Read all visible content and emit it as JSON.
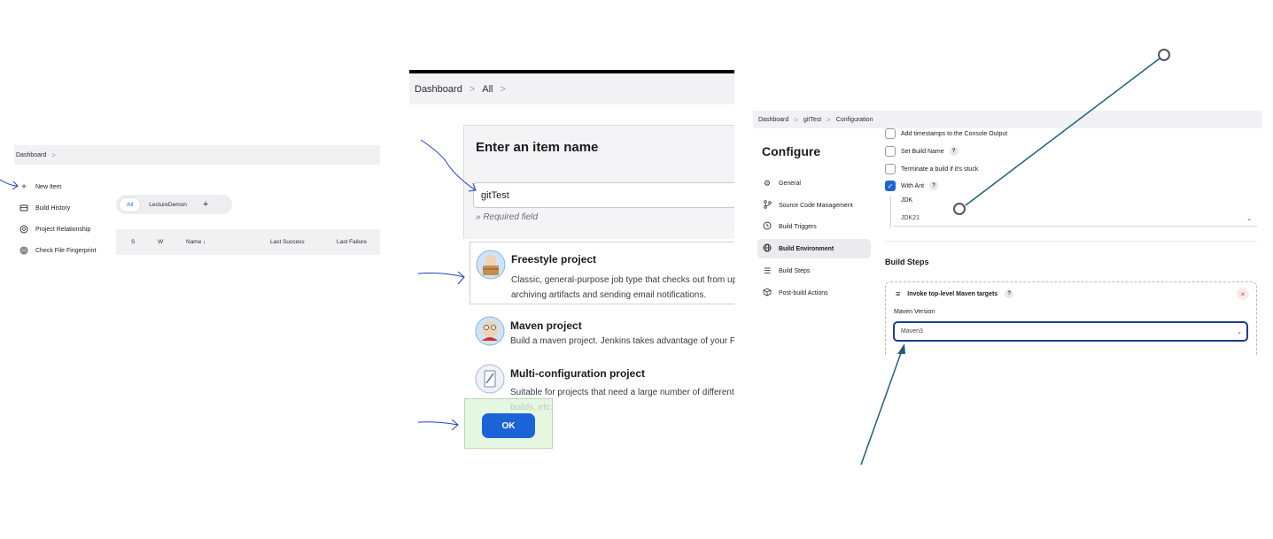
{
  "panel1": {
    "breadcrumb": {
      "home": "Dashboard",
      "sep": ">"
    },
    "sidebar": [
      {
        "label": "New Item",
        "icon": "plus-icon"
      },
      {
        "label": "Build History",
        "icon": "history-icon"
      },
      {
        "label": "Project Relationship",
        "icon": "relationship-icon"
      },
      {
        "label": "Check File Fingerprint",
        "icon": "fingerprint-icon"
      }
    ],
    "tabs": {
      "all": "All",
      "view": "LectureDemon",
      "add": "+"
    },
    "table_headers": {
      "s": "S",
      "w": "W",
      "name": "Name ↓",
      "last_success": "Last Success",
      "last_failure": "Last Failure"
    }
  },
  "panel2": {
    "breadcrumb": {
      "home": "Dashboard",
      "all": "All",
      "sep": ">"
    },
    "title": "Enter an item name",
    "input_value": "gitTest",
    "required_note": "» Required field",
    "projects": [
      {
        "name": "Freestyle project",
        "desc1": "Classic, general-purpose job type that checks out from up to o",
        "desc2": "archiving artifacts and sending email notifications."
      },
      {
        "name": "Maven project",
        "desc1": "Build a maven project. Jenkins takes advantage of your POM f",
        "desc2": ""
      },
      {
        "name": "Multi-configuration project",
        "desc1": "Suitable for projects that need a large number of different con",
        "desc2": "builds, etc."
      }
    ],
    "ok_label": "OK"
  },
  "panel3": {
    "breadcrumb": {
      "home": "Dashboard",
      "job": "gitTest",
      "page": "Configuration",
      "sep": ">"
    },
    "title": "Configure",
    "nav": [
      {
        "label": "General",
        "icon": "gear-icon"
      },
      {
        "label": "Source Code Management",
        "icon": "branch-icon"
      },
      {
        "label": "Build Triggers",
        "icon": "clock-icon"
      },
      {
        "label": "Build Environment",
        "icon": "globe-icon"
      },
      {
        "label": "Build Steps",
        "icon": "list-icon"
      },
      {
        "label": "Post-build Actions",
        "icon": "cube-icon"
      }
    ],
    "options": {
      "timestamps": "Add timestamps to the Console Output",
      "build_name": "Set Build Name",
      "terminate": "Terminate a build if it's stuck",
      "with_ant": "With Ant"
    },
    "help": "?",
    "jdk_label": "JDK",
    "jdk_value": "JDK21",
    "build_steps_heading": "Build Steps",
    "step_title": "Invoke top-level Maven targets",
    "maven_version_label": "Maven Version",
    "maven_value": "Maven3",
    "close": "×"
  },
  "colors": {
    "accent": "#1d63d8",
    "annotation_ink": "#1f3fbf",
    "arrow": "#1f5f7a"
  }
}
